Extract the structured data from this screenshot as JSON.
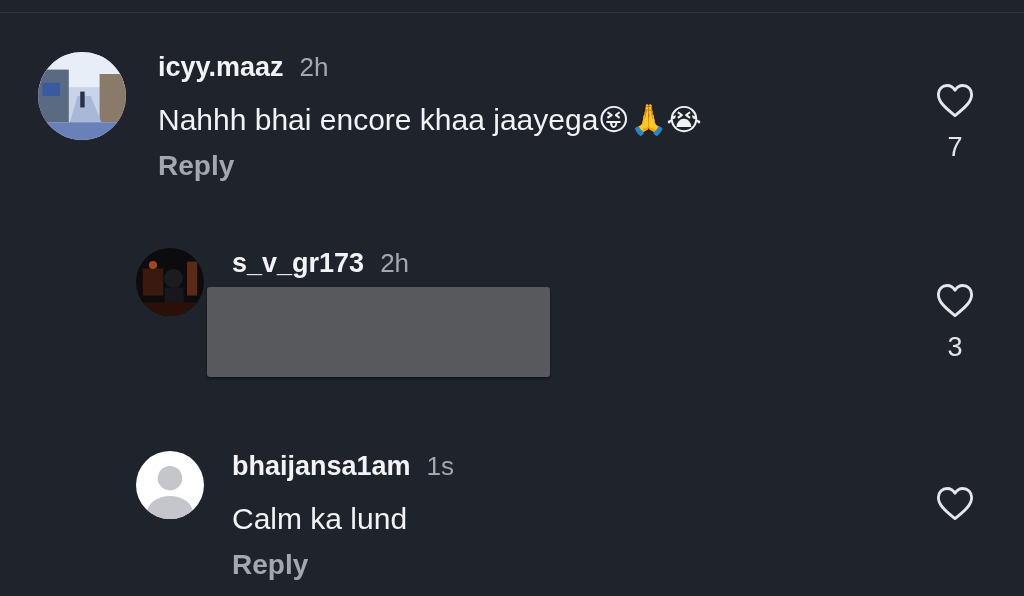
{
  "comments": [
    {
      "username": "icyy.maaz",
      "time": "2h",
      "text": "Nahhh bhai encore khaa jaayega😝🙏😭",
      "reply": "Reply",
      "likes": "7",
      "children": [
        {
          "username": "s_v_gr173",
          "time": "2h",
          "redacted": true,
          "likes": "3"
        },
        {
          "avatar": {
            "kind": "default"
          },
          "username": "bhaijansa1am",
          "time": "1s",
          "text": "Calm ka lund",
          "reply": "Reply"
        }
      ]
    }
  ]
}
